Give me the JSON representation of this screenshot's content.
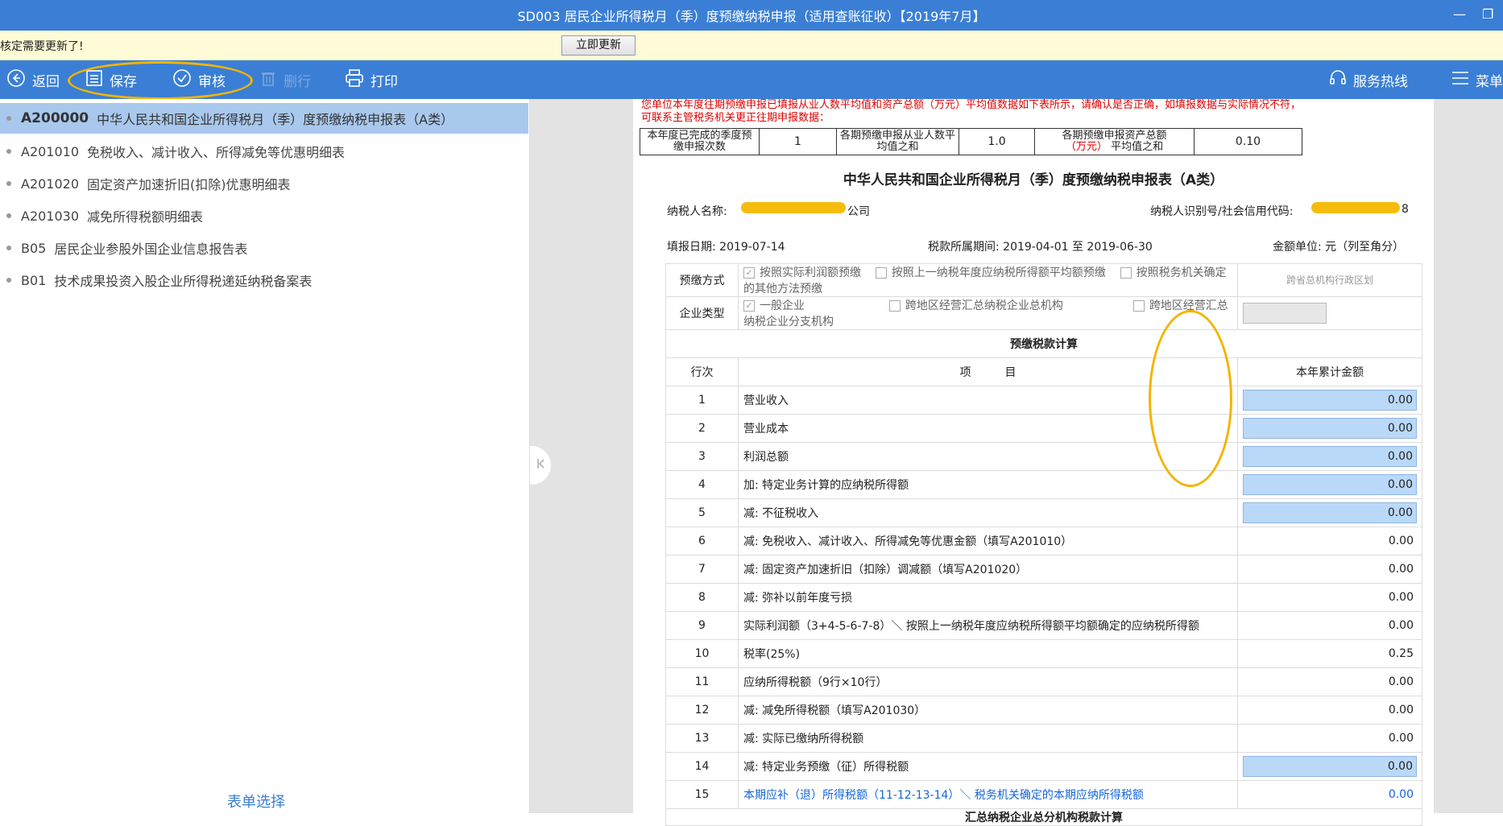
{
  "window": {
    "title": "SD003 居民企业所得税月（季）度预缴纳税申报（适用查账征收）【2019年7月】",
    "minimize": "—",
    "restore": "❐"
  },
  "update_bar": {
    "message": "核定需要更新了!",
    "button": "立即更新"
  },
  "toolbar": {
    "back": "返回",
    "save": "保存",
    "review": "审核",
    "delete": "删行",
    "print": "打印",
    "hotline": "服务热线",
    "menu": "菜单",
    "highlight_color": "#f4b400"
  },
  "sidebar": {
    "items": [
      {
        "code": "A200000",
        "label": "中华人民共和国企业所得税月（季）度预缴纳税申报表（A类）"
      },
      {
        "code": "A201010",
        "label": "免税收入、减计收入、所得减免等优惠明细表"
      },
      {
        "code": "A201020",
        "label": "固定资产加速折旧(扣除)优惠明细表"
      },
      {
        "code": "A201030",
        "label": "减免所得税额明细表"
      },
      {
        "code": "B05",
        "label": "居民企业参股外国企业信息报告表"
      },
      {
        "code": "B01",
        "label": "技术成果投资入股企业所得税递延纳税备案表"
      }
    ],
    "footer": "表单选择"
  },
  "doc": {
    "warning": "您单位本年度往期预缴申报已填报从业人数平均值和资产总额（万元）平均值数据如下表所示，请确认是否正确，如填报数据与实际情况不符，可联系主管税务机关更正往期申报数据：",
    "summary": {
      "l1": "本年度已完成的季度预缴申报次数",
      "v1": "1",
      "l2": "各期预缴申报从业人数平均值之和",
      "v2": "1.0",
      "l3a": "各期预缴申报资产总额",
      "l3b": "（万元）",
      "l3c": "平均值之和",
      "v3": "0.10"
    },
    "title": "中华人民共和国企业所得税月（季）度预缴纳税申报表（A类）",
    "taxpayer_name_label": "纳税人名称:",
    "taxpayer_name_visible": "公司",
    "taxpayer_id_label": "纳税人识别号/社会信用代码:",
    "taxpayer_id_visible": "8",
    "fill_date": "填报日期: 2019-07-14",
    "tax_period": "税款所属期间: 2019-04-01 至 2019-06-30",
    "unit": "金额单位: 元（列至角分）",
    "prepay_label": "预缴方式",
    "prepay_opt1": "按照实际利润额预缴",
    "prepay_opt2": "按照上一纳税年度应纳税所得额平均额预缴",
    "prepay_opt3": "按照税务机关确定的其他方法预缴",
    "cross_region": "跨省总机构行政区划",
    "type_label": "企业类型",
    "type_opt1": "一般企业",
    "type_opt2": "跨地区经营汇总纳税企业总机构",
    "type_opt3": "跨地区经营汇总纳税企业分支机构",
    "section_title": "预缴税款计算",
    "col_row": "行次",
    "col_item": "项　　　目",
    "col_amount": "本年累计金额",
    "rows": [
      {
        "no": "1",
        "item": "营业收入",
        "amount": "0.00",
        "editable": true
      },
      {
        "no": "2",
        "item": "营业成本",
        "amount": "0.00",
        "editable": true
      },
      {
        "no": "3",
        "item": "利润总额",
        "amount": "0.00",
        "editable": true
      },
      {
        "no": "4",
        "item": "加: 特定业务计算的应纳税所得额",
        "amount": "0.00",
        "editable": true
      },
      {
        "no": "5",
        "item": "减: 不征税收入",
        "amount": "0.00",
        "editable": true
      },
      {
        "no": "6",
        "item": "减: 免税收入、减计收入、所得减免等优惠金额（填写A201010）",
        "amount": "0.00",
        "editable": false
      },
      {
        "no": "7",
        "item": "减: 固定资产加速折旧（扣除）调减额（填写A201020）",
        "amount": "0.00",
        "editable": false
      },
      {
        "no": "8",
        "item": "减: 弥补以前年度亏损",
        "amount": "0.00",
        "editable": false
      },
      {
        "no": "9",
        "item": "实际利润额（3+4-5-6-7-8）＼ 按照上一纳税年度应纳税所得额平均额确定的应纳税所得额",
        "amount": "0.00",
        "editable": false
      },
      {
        "no": "10",
        "item": "税率(25%)",
        "amount": "0.25",
        "editable": false
      },
      {
        "no": "11",
        "item": "应纳所得税额（9行×10行）",
        "amount": "0.00",
        "editable": false
      },
      {
        "no": "12",
        "item": "减: 减免所得税额（填写A201030）",
        "amount": "0.00",
        "editable": false
      },
      {
        "no": "13",
        "item": "减: 实际已缴纳所得税额",
        "amount": "0.00",
        "editable": false
      },
      {
        "no": "14",
        "item": "减: 特定业务预缴（征）所得税额",
        "amount": "0.00",
        "editable": true
      },
      {
        "no": "15",
        "item": "本期应补（退）所得税额（11-12-13-14）＼ 税务机关确定的本期应纳所得税额",
        "amount": "0.00",
        "editable": false,
        "blue": true
      }
    ],
    "next_section": "汇总纳税企业总分机构税款计算"
  }
}
